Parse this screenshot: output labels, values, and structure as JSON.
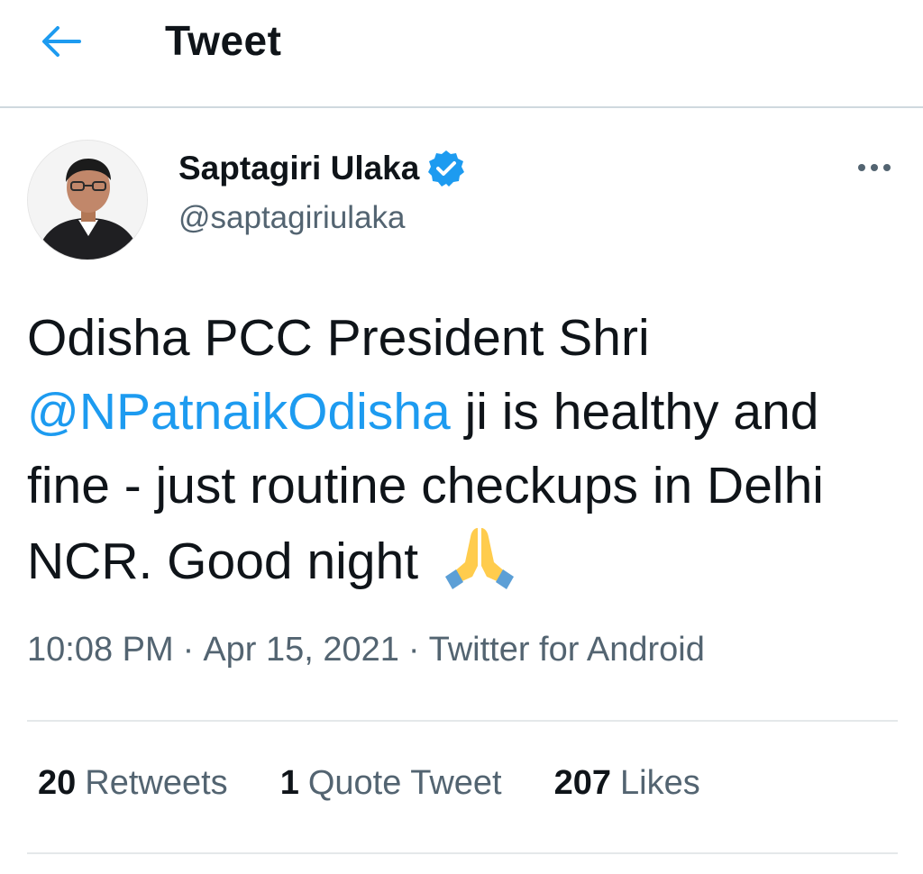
{
  "header": {
    "back_icon": "arrow-left-icon",
    "title": "Tweet"
  },
  "author": {
    "name": "Saptagiri Ulaka",
    "handle": "@saptagiriulaka",
    "verified_icon": "verified-badge-icon",
    "avatar": "avatar-photo"
  },
  "more_icon": "more-options-icon",
  "tweet": {
    "text_part1": "Odisha PCC President Shri ",
    "mention": "@NPatnaikOdisha",
    "text_part2": " ji is healthy and fine - just routine checkups in Delhi NCR. Good night ",
    "emoji_icon": "folded-hands-icon"
  },
  "meta": {
    "time": "10:08 PM",
    "separator": "·",
    "date": "Apr 15, 2021",
    "source": "Twitter for Android"
  },
  "stats": {
    "retweets_count": "20",
    "retweets_label": "Retweets",
    "quotes_count": "1",
    "quotes_label": "Quote Tweet",
    "likes_count": "207",
    "likes_label": "Likes"
  },
  "colors": {
    "accent": "#1d9bf0",
    "text_primary": "#0f1419",
    "text_secondary": "#536471",
    "divider": "#e4e8ea"
  }
}
